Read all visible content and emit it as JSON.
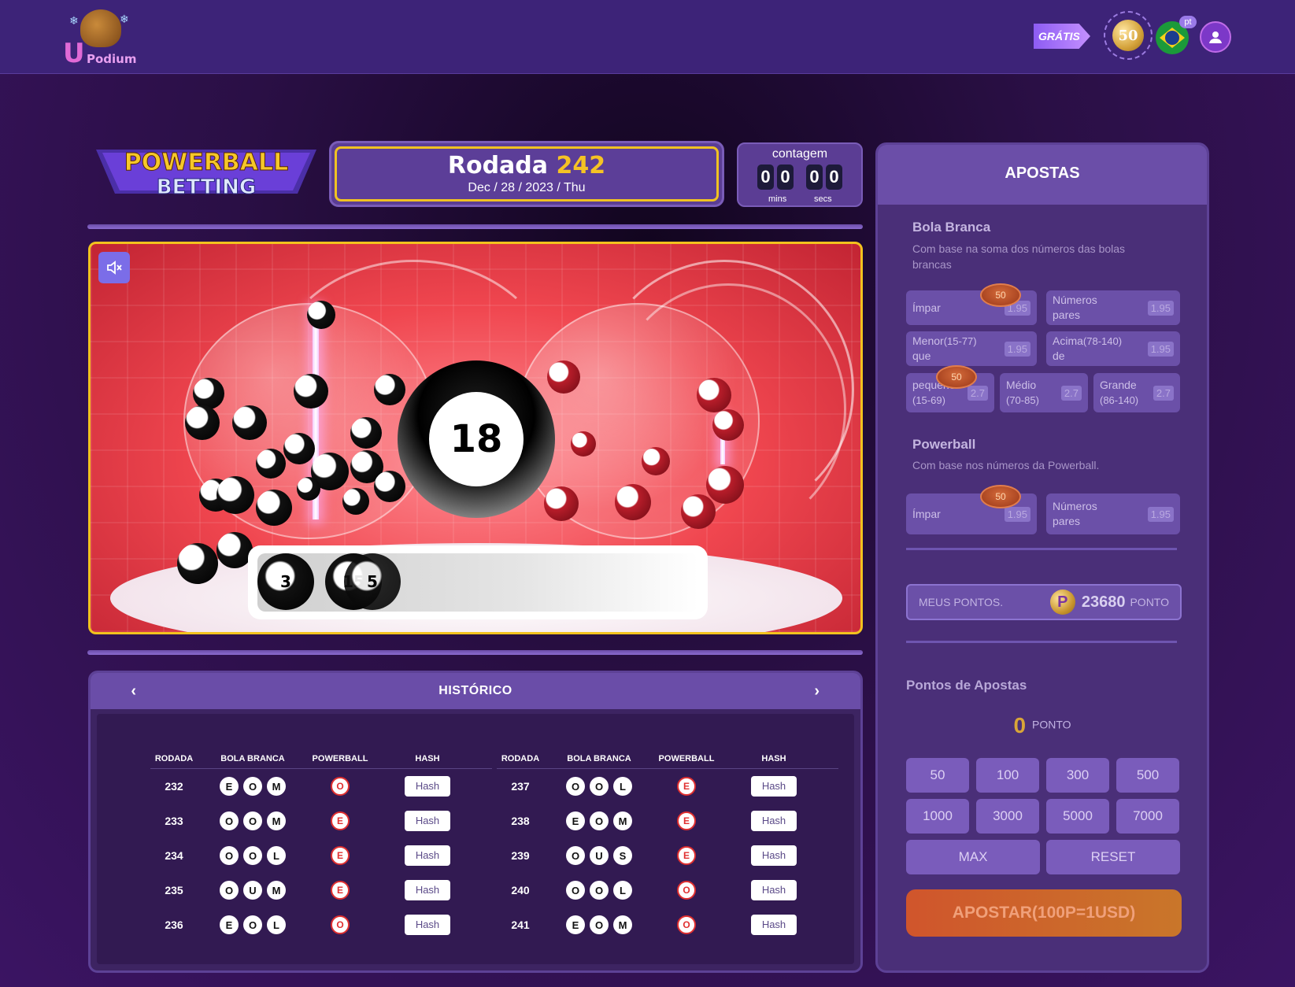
{
  "header": {
    "logo_text": "Podium",
    "gratis_label": "GRÁTIS",
    "coin_value": "50",
    "language_badge": "pt",
    "icons": [
      "gift-arrow-icon",
      "coin-icon",
      "brazil-flag-icon",
      "user-icon"
    ]
  },
  "game": {
    "logo_line1": "POWERBALL",
    "logo_line2": "BETTING",
    "round_label": "Rodada",
    "round_number": "242",
    "date": "Dec / 28 / 2023 / Thu",
    "countdown_title": "contagem",
    "digits": [
      "0",
      "0",
      "0",
      "0"
    ],
    "mins_label": "mins",
    "secs_label": "secs",
    "current_ball": "18",
    "tray_balls": [
      "3",
      "15",
      "5"
    ]
  },
  "history": {
    "title": "HISTÓRICO",
    "prev": "‹",
    "next": "›",
    "headers": [
      "RODADA",
      "BOLA BRANCA",
      "POWERBALL",
      "HASH"
    ],
    "hash_label": "Hash",
    "left": [
      {
        "round": "232",
        "white": [
          "E",
          "O",
          "M"
        ],
        "power": "O"
      },
      {
        "round": "233",
        "white": [
          "O",
          "O",
          "M"
        ],
        "power": "E"
      },
      {
        "round": "234",
        "white": [
          "O",
          "O",
          "L"
        ],
        "power": "E"
      },
      {
        "round": "235",
        "white": [
          "O",
          "U",
          "M"
        ],
        "power": "E"
      },
      {
        "round": "236",
        "white": [
          "E",
          "O",
          "L"
        ],
        "power": "O"
      }
    ],
    "right": [
      {
        "round": "237",
        "white": [
          "O",
          "O",
          "L"
        ],
        "power": "E"
      },
      {
        "round": "238",
        "white": [
          "E",
          "O",
          "M"
        ],
        "power": "E"
      },
      {
        "round": "239",
        "white": [
          "O",
          "U",
          "S"
        ],
        "power": "E"
      },
      {
        "round": "240",
        "white": [
          "O",
          "O",
          "L"
        ],
        "power": "O"
      },
      {
        "round": "241",
        "white": [
          "E",
          "O",
          "M"
        ],
        "power": "O"
      }
    ]
  },
  "bets": {
    "title": "APOSTAS",
    "white_title": "Bola Branca",
    "white_desc": "Com base na soma dos números das bolas brancas",
    "white_options": {
      "impar": {
        "label": "Ímpar",
        "odd": "1.95"
      },
      "pares": {
        "label1": "Números",
        "label2": "pares",
        "odd": "1.95"
      },
      "menor": {
        "label1": "Menor",
        "label2": "que",
        "range": "(15-77)",
        "odd": "1.95"
      },
      "acima": {
        "label1": "Acima",
        "label2": "de",
        "range": "(78-140)",
        "odd": "1.95"
      },
      "pequeno": {
        "label1": "pequeno",
        "label2": "(15-69)",
        "odd": "2.7"
      },
      "medio": {
        "label1": "Médio",
        "label2": "(70-85)",
        "odd": "2.7"
      },
      "grande": {
        "label1": "Grande",
        "label2": "(86-140)",
        "odd": "2.7"
      }
    },
    "power_title": "Powerball",
    "power_desc": "Com base nos números da Powerball.",
    "power_options": {
      "impar": {
        "label": "Ímpar",
        "odd": "1.95"
      },
      "pares": {
        "label1": "Números",
        "label2": "pares",
        "odd": "1.95"
      }
    },
    "chip_value": "50",
    "points_label": "MEUS PONTOS.",
    "points_icon": "P",
    "points_value": "23680",
    "points_unit": "PONTO",
    "bet_points_title": "Pontos de Apostas",
    "bet_points_value": "0",
    "bet_points_unit": "PONTO",
    "amounts": [
      "50",
      "100",
      "300",
      "500",
      "1000",
      "3000",
      "5000",
      "7000"
    ],
    "max_label": "MAX",
    "reset_label": "RESET",
    "submit_label": "APOSTAR(100P=1USD)"
  }
}
